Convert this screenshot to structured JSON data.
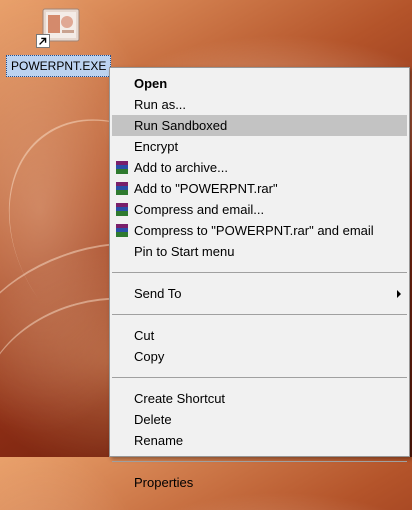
{
  "desktop": {
    "icon_label": "POWERPNT.EXE"
  },
  "menu": {
    "items": [
      {
        "label": "Open"
      },
      {
        "label": "Run as..."
      },
      {
        "label": "Run Sandboxed"
      },
      {
        "label": "Encrypt"
      },
      {
        "label": "Add to archive..."
      },
      {
        "label": "Add to \"POWERPNT.rar\""
      },
      {
        "label": "Compress and email..."
      },
      {
        "label": "Compress to \"POWERPNT.rar\" and email"
      },
      {
        "label": "Pin to Start menu"
      },
      {
        "label": "Send To"
      },
      {
        "label": "Cut"
      },
      {
        "label": "Copy"
      },
      {
        "label": "Create Shortcut"
      },
      {
        "label": "Delete"
      },
      {
        "label": "Rename"
      },
      {
        "label": "Properties"
      }
    ],
    "highlighted": "Run Sandboxed",
    "icons": {
      "winrar": "winrar-books-icon",
      "submenu": "chevron-right-icon"
    }
  }
}
